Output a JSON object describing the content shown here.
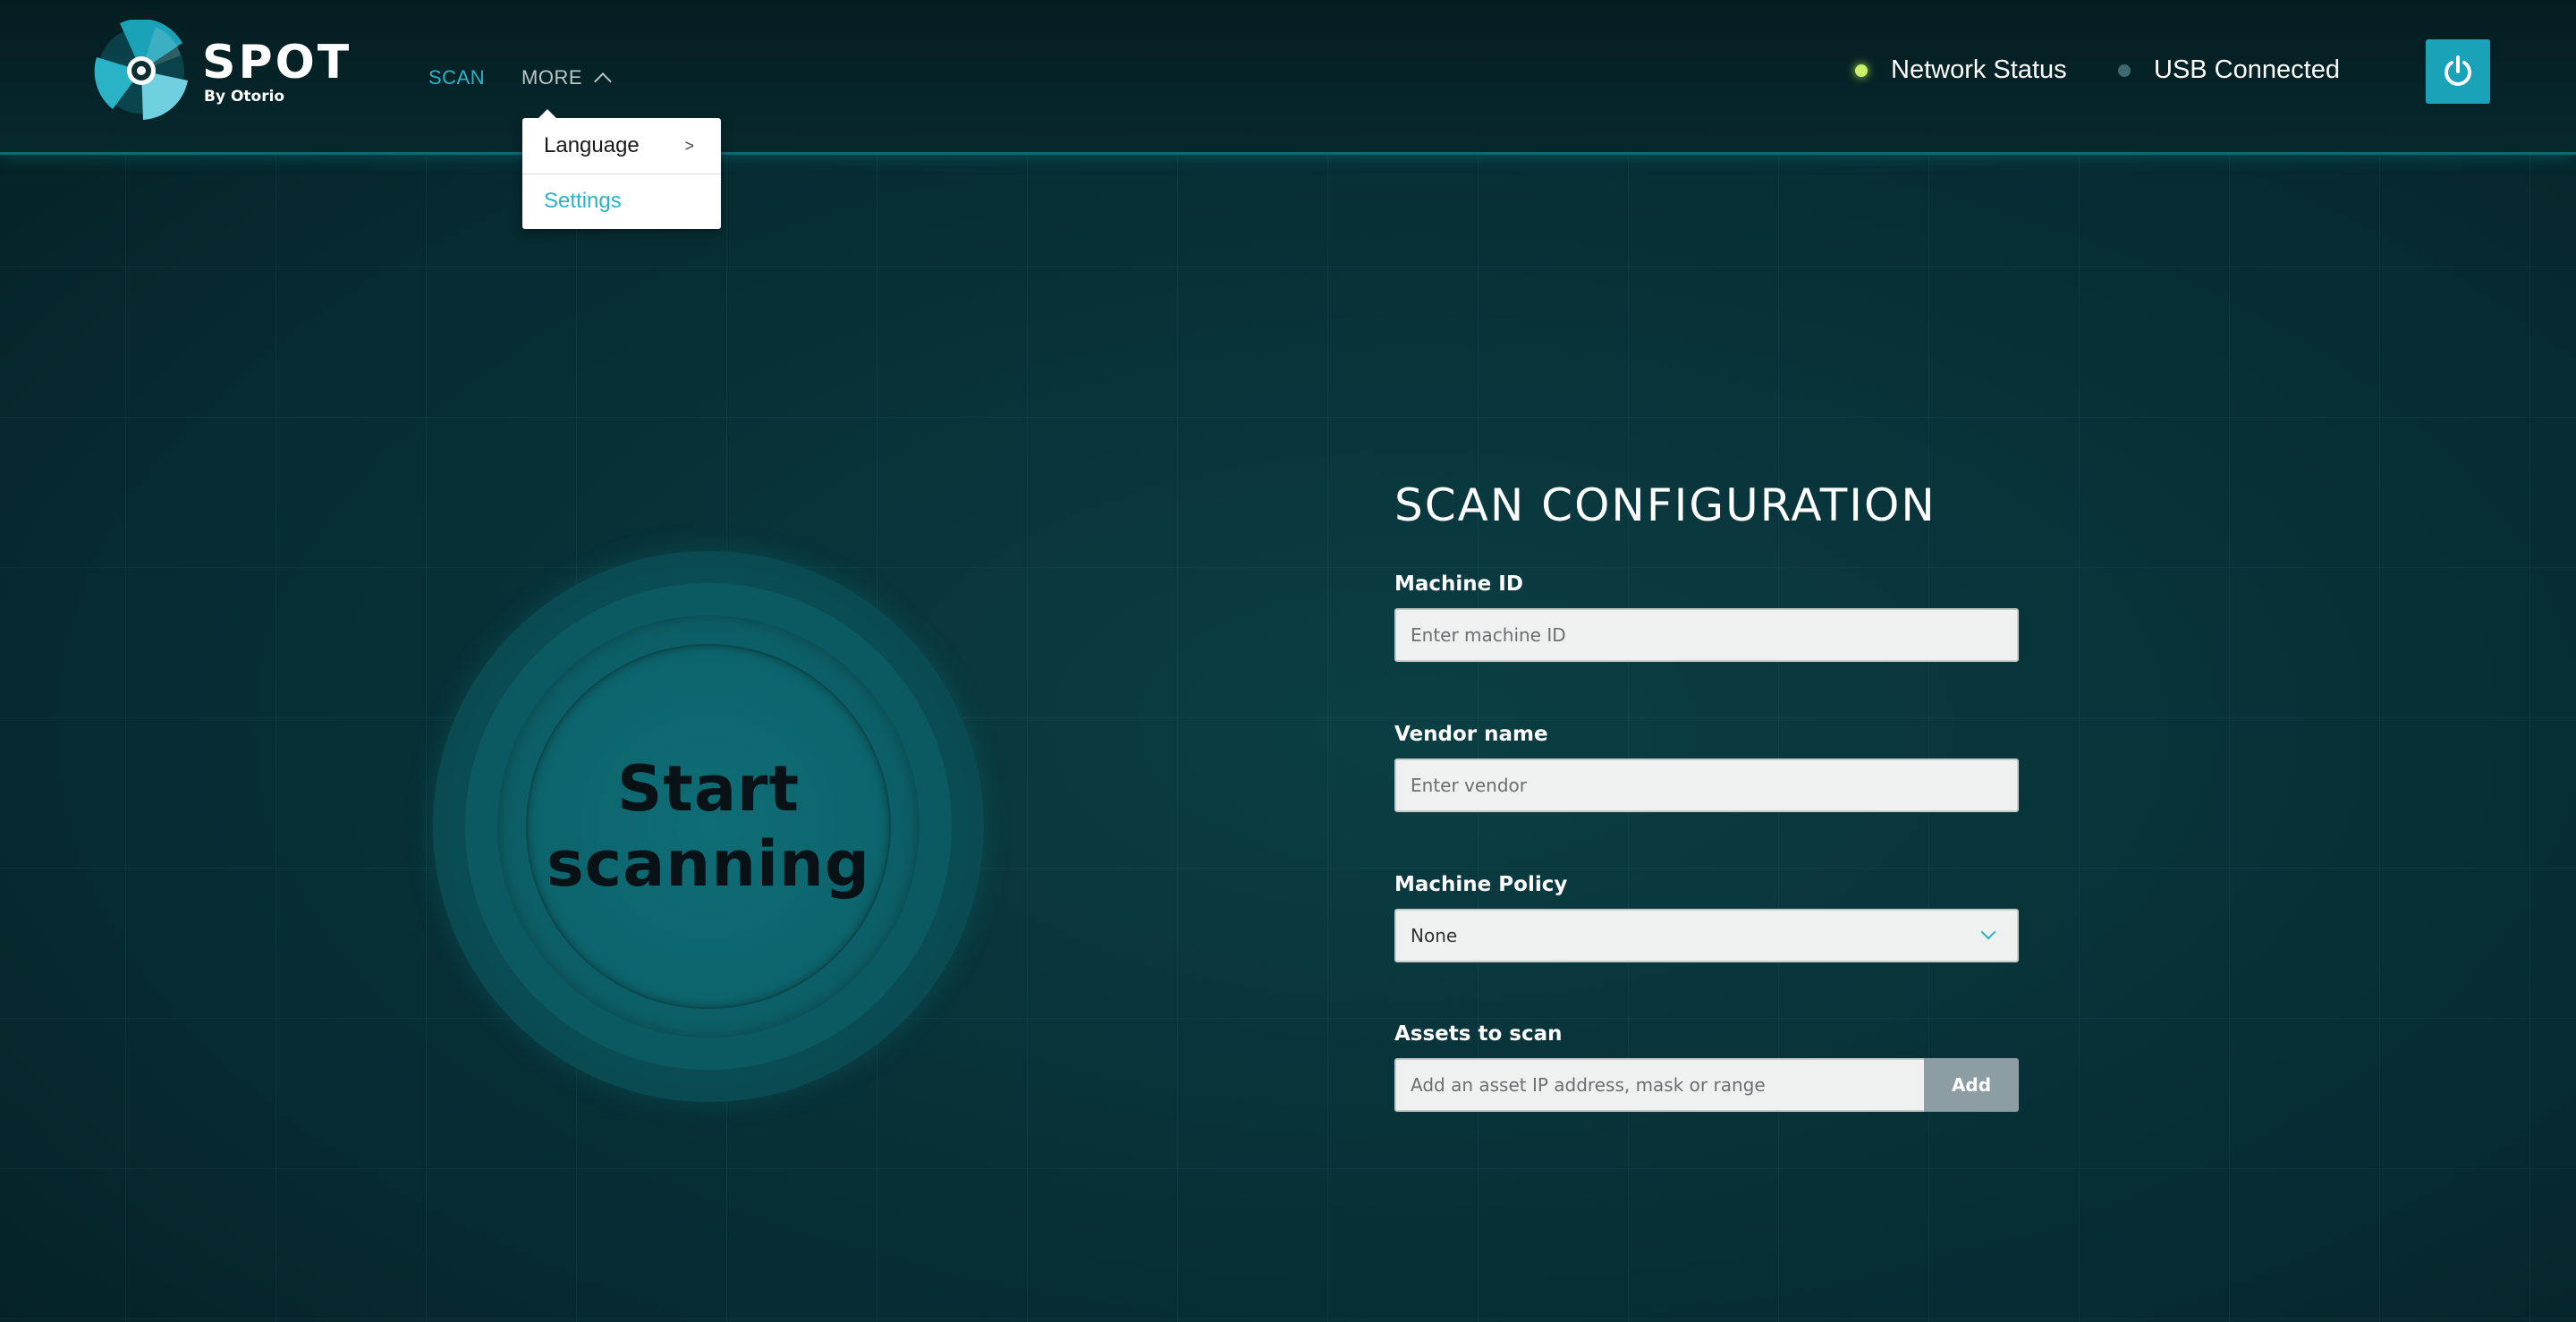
{
  "app": {
    "logo_text": "SPOT",
    "logo_subtext": "By Otorio"
  },
  "nav": {
    "scan_label": "SCAN",
    "more_label": "MORE"
  },
  "more_menu": {
    "items": [
      {
        "label": "Language",
        "has_submenu": true,
        "submenu_indicator": ">"
      },
      {
        "label": "Settings",
        "active": true
      }
    ]
  },
  "status": {
    "network_label": "Network Status",
    "network_state_color": "#c9f06a",
    "usb_label": "USB Connected",
    "usb_state_color": "#3c6a6e"
  },
  "power": {
    "icon": "power-icon"
  },
  "scan_button": {
    "line1": "Start",
    "line2": "scanning"
  },
  "scan_configuration": {
    "title": "SCAN CONFIGURATION",
    "machine_id": {
      "label": "Machine ID",
      "placeholder": "Enter machine ID",
      "value": ""
    },
    "vendor_name": {
      "label": "Vendor name",
      "placeholder": "Enter vendor",
      "value": ""
    },
    "machine_policy": {
      "label": "Machine Policy",
      "selected": "None"
    },
    "assets_to_scan": {
      "label": "Assets to scan",
      "placeholder": "Add an asset IP address, mask or range",
      "value": "",
      "add_label": "Add"
    }
  },
  "colors": {
    "accent": "#2ab3c7",
    "power_button": "#1aa3b8",
    "background": "#08343a"
  }
}
